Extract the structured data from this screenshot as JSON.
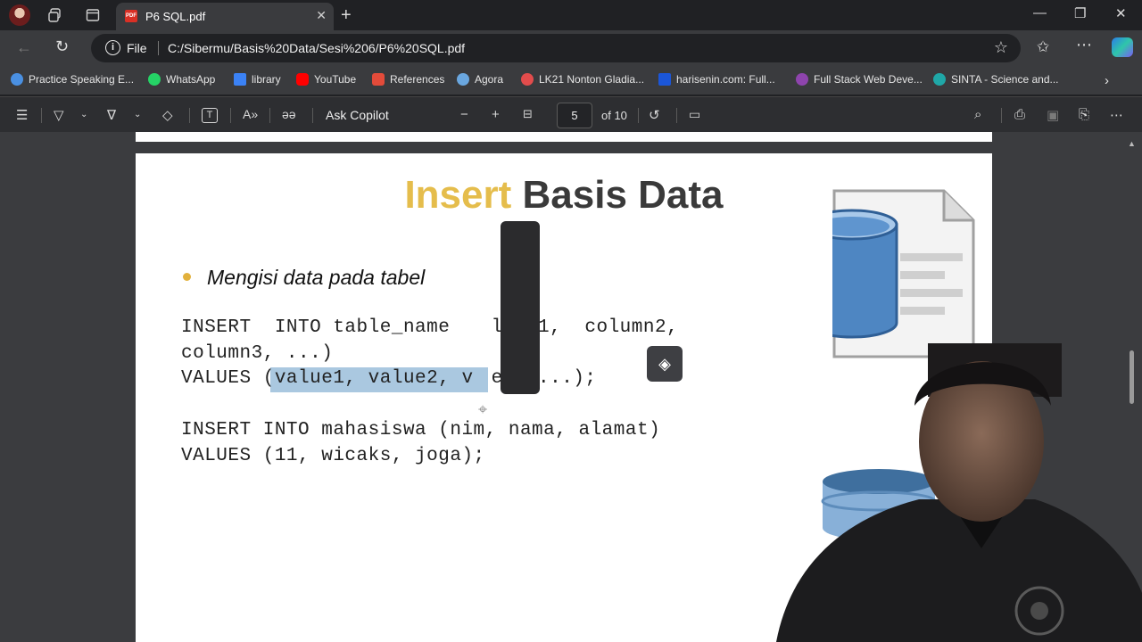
{
  "tab": {
    "title": "P6 SQL.pdf",
    "favicon": "PDF"
  },
  "address": {
    "scheme_label": "File",
    "url": "C:/Sibermu/Basis%20Data/Sesi%206/P6%20SQL.pdf"
  },
  "bookmarks": [
    {
      "label": "Practice Speaking E...",
      "color": "#4a90e2"
    },
    {
      "label": "WhatsApp",
      "color": "#25d366"
    },
    {
      "label": "library",
      "color": "#3b82f6"
    },
    {
      "label": "YouTube",
      "color": "#ff0000"
    },
    {
      "label": "References",
      "color": "#e34b3a"
    },
    {
      "label": "Agora",
      "color": "#6aa7e0"
    },
    {
      "label": "LK21 Nonton Gladia...",
      "color": "#e24c4c"
    },
    {
      "label": "harisenin.com: Full...",
      "color": "#1b56d8"
    },
    {
      "label": "Full Stack Web Deve...",
      "color": "#8e44ad"
    },
    {
      "label": "SINTA - Science and...",
      "color": "#1fa7a7"
    }
  ],
  "pdf_toolbar": {
    "ask_copilot": "Ask Copilot",
    "page_current": "5",
    "page_total": "of 10"
  },
  "slide": {
    "title_word1": "Insert",
    "title_word2": "Basis Data",
    "bullet": "Mengisi data pada tabel",
    "code_line1_a": "INSERT  INTO table_name  ",
    "code_line1_b": "lumn1,  column2,",
    "code_line2": "column3, ...)",
    "code_line3_a": "VALUES ",
    "code_line3_hl": "(value1, value2, ",
    "code_line3_b": "v",
    "code_line3_c": "e3, ...);",
    "code_line4": "INSERT INTO mahasiswa (nim, nama, alamat)",
    "code_line5": "VALUES (11, wicaks, joga);"
  }
}
